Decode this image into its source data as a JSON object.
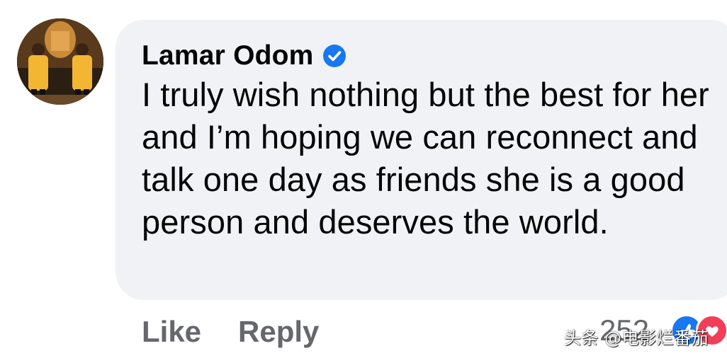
{
  "comment": {
    "author": "Lamar Odom",
    "verified_icon": "verified-badge-icon",
    "text": "I truly wish nothing but the best for her and I’m hoping we can reconnect and talk one day as friends she is a good person and deserves the world.",
    "actions": {
      "like_label": "Like",
      "reply_label": "Reply"
    },
    "reactions": {
      "count": "252",
      "icons": [
        "like-reaction-icon",
        "love-reaction-icon"
      ]
    }
  },
  "watermark": "头条 @电影烂番茄",
  "colors": {
    "bubble": "#f0f2f5",
    "action_text": "#65676b",
    "verified": "#1877f2",
    "like": "#1877f2",
    "love": "#f33e58"
  }
}
